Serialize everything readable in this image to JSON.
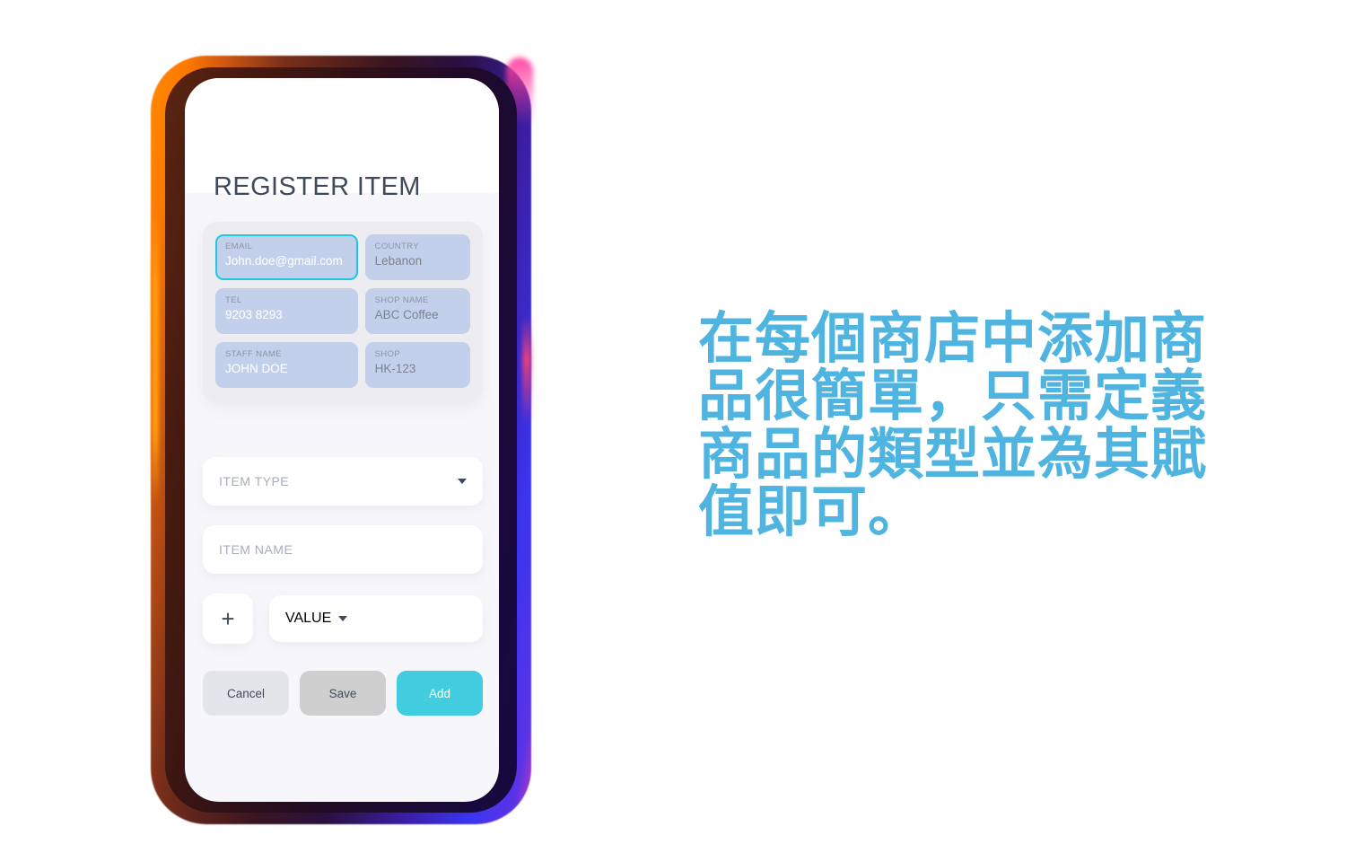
{
  "phone": {
    "screen": {
      "page_title": "REGISTER ITEM",
      "info_card": {
        "fields": [
          {
            "label": "EMAIL",
            "value": "John.doe@gmail.com",
            "column": "left",
            "focused": true,
            "value_style": "white"
          },
          {
            "label": "COUNTRY",
            "value": "Lebanon",
            "column": "right",
            "focused": false,
            "value_style": "muted"
          },
          {
            "label": "TEL",
            "value": "9203 8293",
            "column": "left",
            "focused": false,
            "value_style": "white"
          },
          {
            "label": "SHOP NAME",
            "value": "ABC Coffee",
            "column": "right",
            "focused": false,
            "value_style": "muted"
          },
          {
            "label": "STAFF NAME",
            "value": "JOHN DOE",
            "column": "left",
            "focused": false,
            "value_style": "white"
          },
          {
            "label": "SHOP",
            "value": "HK-123",
            "column": "right",
            "focused": false,
            "value_style": "muted"
          }
        ]
      },
      "controls": {
        "item_type": {
          "label": "ITEM TYPE",
          "type": "dropdown",
          "value": "",
          "placeholder": "ITEM TYPE"
        },
        "item_name": {
          "label": "ITEM NAME",
          "type": "text",
          "value": "",
          "placeholder": "ITEM NAME"
        },
        "add_attribute_icon": "plus-icon",
        "value_select": {
          "label": "VALUE",
          "type": "dropdown",
          "value": "",
          "placeholder": "VALUE"
        }
      },
      "buttons": {
        "cancel": "Cancel",
        "save": "Save",
        "add": "Add"
      }
    },
    "colors": {
      "rim_left": "#ff8a00",
      "rim_right": "#3b35f0",
      "rim_accent_pink": "#ff3fa0",
      "bezel": "#2e1018",
      "screen_bg": "#f7f7fb",
      "field_bg": "#c3d0ec",
      "field_focus_border": "#1ec8e3",
      "card_bg": "#ededf1",
      "title_text": "#3f4a5b",
      "add_button": "#41ccdf",
      "save_button": "#cfcfcf",
      "cancel_button": "#e3e5eb"
    }
  },
  "caption": {
    "text": "在每個商店中添加商品很簡單，只需定義商品的類型並為其賦值即可。",
    "color": "#4fb5e0"
  }
}
